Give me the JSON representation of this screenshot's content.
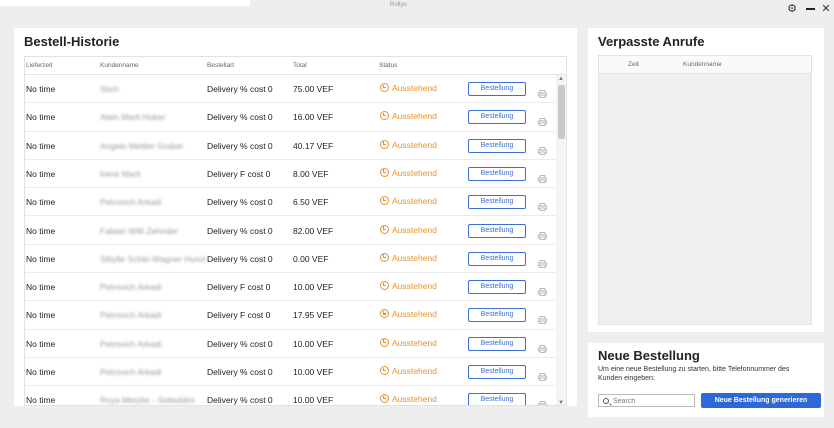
{
  "window": {
    "title": "Rollyo"
  },
  "history": {
    "title": "Bestell-Historie",
    "columns": [
      "Lieferzeit",
      "Kundenname",
      "Bestellart",
      "Total",
      "Status"
    ],
    "button_label": "Bestellung",
    "rows": [
      {
        "time": "No time",
        "name": "Stich",
        "type": "Delivery % cost 0",
        "total": "75.00 VEF",
        "status": "Ausstehend"
      },
      {
        "time": "No time",
        "name": "Alain Marti Huber",
        "type": "Delivery % cost 0",
        "total": "16.00 VEF",
        "status": "Ausstehend"
      },
      {
        "time": "No time",
        "name": "Angelo Mettler Graber",
        "type": "Delivery % cost 0",
        "total": "40.17 VEF",
        "status": "Ausstehend"
      },
      {
        "time": "No time",
        "name": "Irene Marti",
        "type": "Delivery F cost 0",
        "total": "8.00 VEF",
        "status": "Ausstehend"
      },
      {
        "time": "No time",
        "name": "Petrovich Arkadi",
        "type": "Delivery % cost 0",
        "total": "6.50 VEF",
        "status": "Ausstehend"
      },
      {
        "time": "No time",
        "name": "Fabian Willi Zehnder",
        "type": "Delivery % cost 0",
        "total": "82.00 VEF",
        "status": "Ausstehend"
      },
      {
        "time": "No time",
        "name": "Sibylle Schär-Wagner Hunzi",
        "type": "Delivery % cost 0",
        "total": "0.00 VEF",
        "status": "Ausstehend"
      },
      {
        "time": "No time",
        "name": "Petrovich Arkadi",
        "type": "Delivery F cost 0",
        "total": "10.00 VEF",
        "status": "Ausstehend"
      },
      {
        "time": "No time",
        "name": "Petrovich Arkadi",
        "type": "Delivery F cost 0",
        "total": "17.95 VEF",
        "status": "Ausstehend"
      },
      {
        "time": "No time",
        "name": "Petrovich Arkadi",
        "type": "Delivery % cost 0",
        "total": "10.00 VEF",
        "status": "Ausstehend"
      },
      {
        "time": "No time",
        "name": "Petrovich Arkadi",
        "type": "Delivery % cost 0",
        "total": "10.00 VEF",
        "status": "Ausstehend"
      },
      {
        "time": "No time",
        "name": "Roya Metzler - Selleddini",
        "type": "Delivery % cost 0",
        "total": "10.00 VEF",
        "status": "Ausstehend"
      }
    ]
  },
  "missed_calls": {
    "title": "Verpasste Anrufe",
    "columns": [
      "Zeit",
      "Kundenname"
    ]
  },
  "new_order": {
    "title": "Neue Bestellung",
    "hint": "Um eine neue Bestellung zu starten, bitte Telefonnummer des Kunden eingeben:",
    "search_placeholder": "Search",
    "button_label": "Neue Bestellung generieren"
  },
  "colors": {
    "accent": "#2d68d8",
    "pending": "#e8922a"
  }
}
